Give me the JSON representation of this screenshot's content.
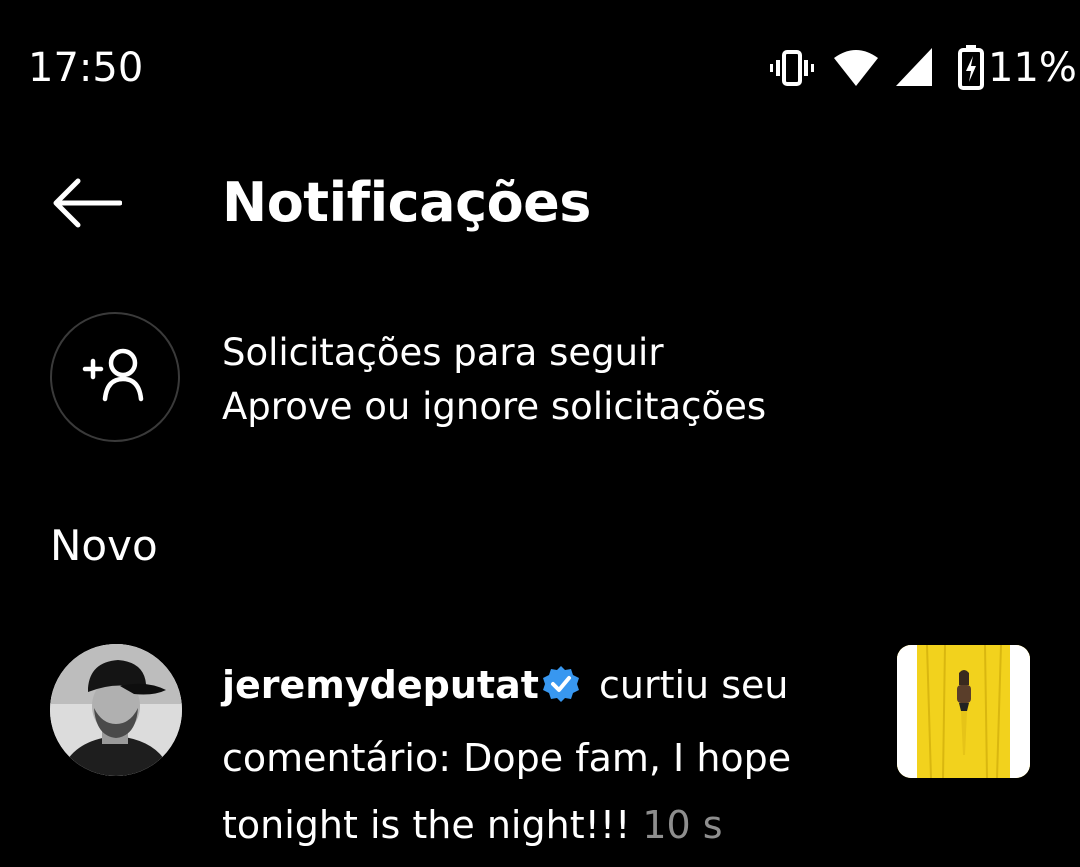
{
  "status_bar": {
    "time": "17:50",
    "battery_percent": "11%",
    "icons": [
      "vibrate-icon",
      "wifi-icon",
      "cell-signal-icon",
      "battery-charging-icon"
    ]
  },
  "header": {
    "back_icon": "arrow-left-icon",
    "title": "Notificações"
  },
  "follow_requests": {
    "icon": "add-person-icon",
    "title": "Solicitações para seguir",
    "subtitle": "Aprove ou ignore solicitações"
  },
  "sections": {
    "new_heading": "Novo"
  },
  "notifications": [
    {
      "username": "jeremydeputat",
      "verified": true,
      "action": " curtiu seu comentário: Dope fam, I hope tonight is the night!!! ",
      "time_ago": "10 s"
    }
  ],
  "colors": {
    "background": "#000000",
    "text": "#ffffff",
    "muted": "#8e8e8e",
    "verified_blue": "#3897f0",
    "thumbnail_yellow": "#f2d21d"
  }
}
